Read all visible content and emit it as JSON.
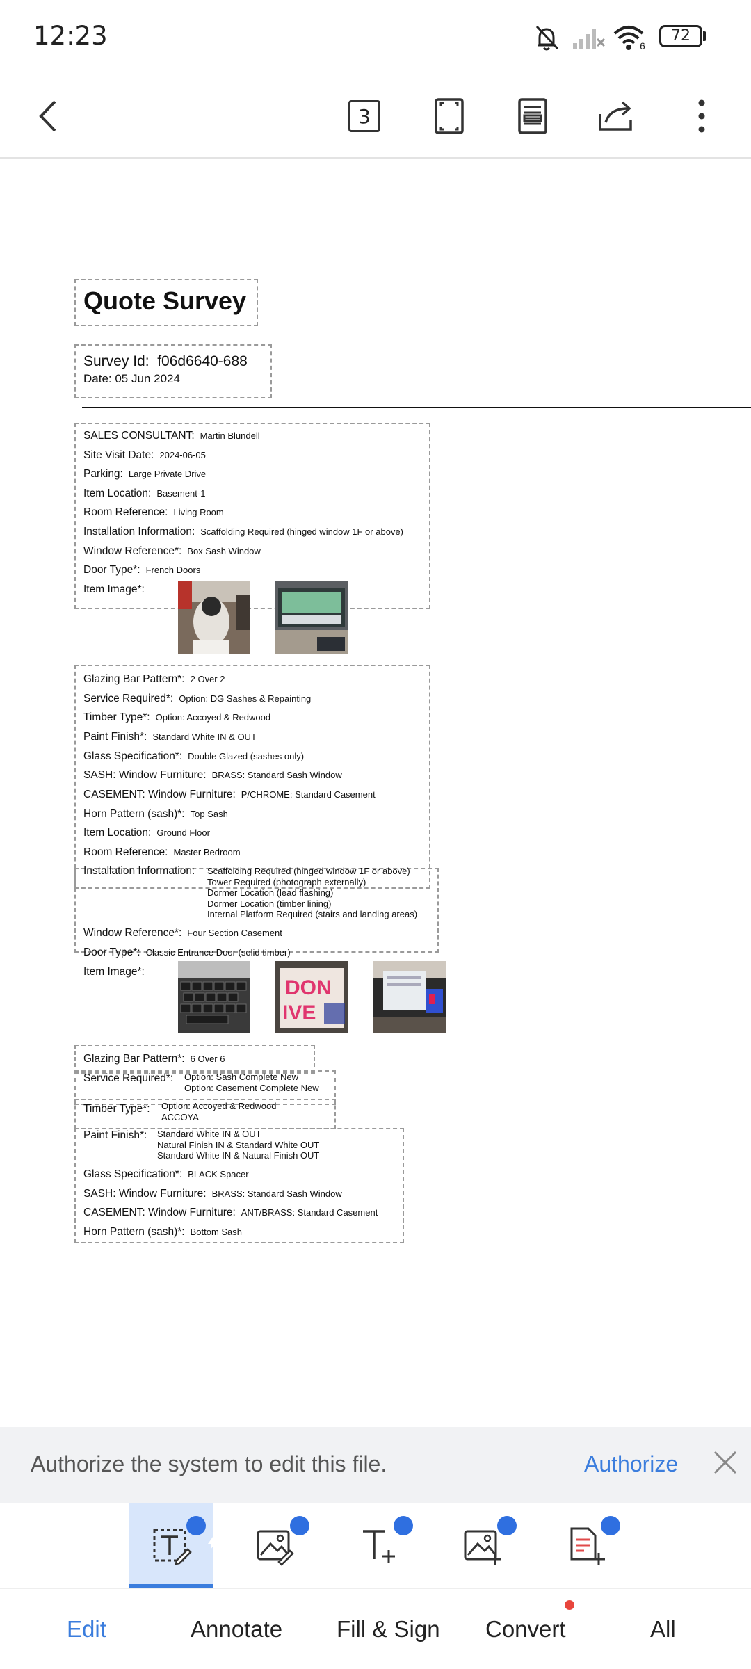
{
  "status_bar": {
    "time": "12:23",
    "battery": "72",
    "network": "6"
  },
  "toolbar": {
    "page_count": "3"
  },
  "document": {
    "title": "Quote Survey",
    "survey_id_label": "Survey Id:",
    "survey_id": "f06d6640-688",
    "date_label": "Date: 05 Jun 2024",
    "section1": [
      {
        "label": "SALES CONSULTANT:",
        "value": "Martin Blundell"
      },
      {
        "label": "Site Visit Date:",
        "value": "2024-06-05"
      },
      {
        "label": "Parking:",
        "value": "Large Private Drive"
      },
      {
        "label": "Item Location:",
        "value": "Basement-1"
      },
      {
        "label": "Room Reference:",
        "value": "Living Room"
      },
      {
        "label": "Installation Information:",
        "value": "Scaffolding Required (hinged window 1F or above)"
      },
      {
        "label": "Window Reference*:",
        "value": "Box Sash Window"
      },
      {
        "label": "Door Type*:",
        "value": "French Doors"
      },
      {
        "label": "Item Image*:",
        "value": ""
      }
    ],
    "section2": [
      {
        "label": "Glazing Bar Pattern*:",
        "value": "2 Over 2"
      },
      {
        "label": "Service Required*:",
        "value": "Option: DG Sashes & Repainting"
      },
      {
        "label": "Timber Type*:",
        "value": "Option: Accoyed & Redwood"
      },
      {
        "label": "Paint Finish*:",
        "value": "Standard White IN & OUT"
      },
      {
        "label": "Glass Specification*:",
        "value": "Double Glazed (sashes only)"
      },
      {
        "label": "SASH: Window Furniture:",
        "value": "BRASS: Standard Sash Window"
      },
      {
        "label": "CASEMENT: Window Furniture:",
        "value": "P/CHROME: Standard Casement"
      },
      {
        "label": "Horn Pattern (sash)*:",
        "value": "Top Sash"
      },
      {
        "label": "Item Location:",
        "value": "Ground Floor"
      },
      {
        "label": "Room Reference:",
        "value": "Master Bedroom"
      }
    ],
    "section2_install_label": "Installation Information:",
    "section2_install_lines": [
      "Scaffolding Required (hinged window 1F or above)",
      "Tower Required (photograph externally)",
      "Dormer Location (lead flashing)",
      "Dormer Location (timber lining)",
      "Internal Platform Required (stairs and landing areas)"
    ],
    "section2_tail": [
      {
        "label": "Window Reference*:",
        "value": "Four Section Casement"
      },
      {
        "label": "Door Type*:",
        "value": "Classic Entrance Door (solid timber)"
      },
      {
        "label": "Item Image*:",
        "value": ""
      }
    ],
    "section3": {
      "glazing_label": "Glazing Bar Pattern*:",
      "glazing_value": "6 Over 6",
      "service_label": "Service Required*:",
      "service_lines": [
        "Option: Sash Complete New",
        "Option: Casement Complete New"
      ],
      "timber_label": "Timber Type*:",
      "timber_lines": [
        "Option: Accoyed & Redwood",
        "ACCOYA"
      ],
      "paint_label": "Paint Finish*:",
      "paint_lines": [
        "Standard White IN & OUT",
        "Natural Finish IN & Standard White OUT",
        "Standard White IN & Natural Finish OUT"
      ],
      "glass_label": "Glass Specification*:",
      "glass_value": "BLACK Spacer",
      "sash_label": "SASH: Window Furniture:",
      "sash_value": "BRASS: Standard Sash Window",
      "casement_label": "CASEMENT: Window Furniture:",
      "casement_value": "ANT/BRASS: Standard Casement",
      "horn_label": "Horn Pattern (sash)*:",
      "horn_value": "Bottom Sash"
    },
    "photo_text": "DON IVE"
  },
  "banner": {
    "text": "Authorize the system to edit this file.",
    "action": "Authorize"
  },
  "tabs": {
    "edit": "Edit",
    "annotate": "Annotate",
    "fill_sign": "Fill & Sign",
    "convert": "Convert",
    "all": "All"
  },
  "colors": {
    "accent": "#3b7ddd",
    "badge": "#2f6fe0",
    "selected_bg": "#d8e6fb",
    "dot": "#e8453c"
  }
}
